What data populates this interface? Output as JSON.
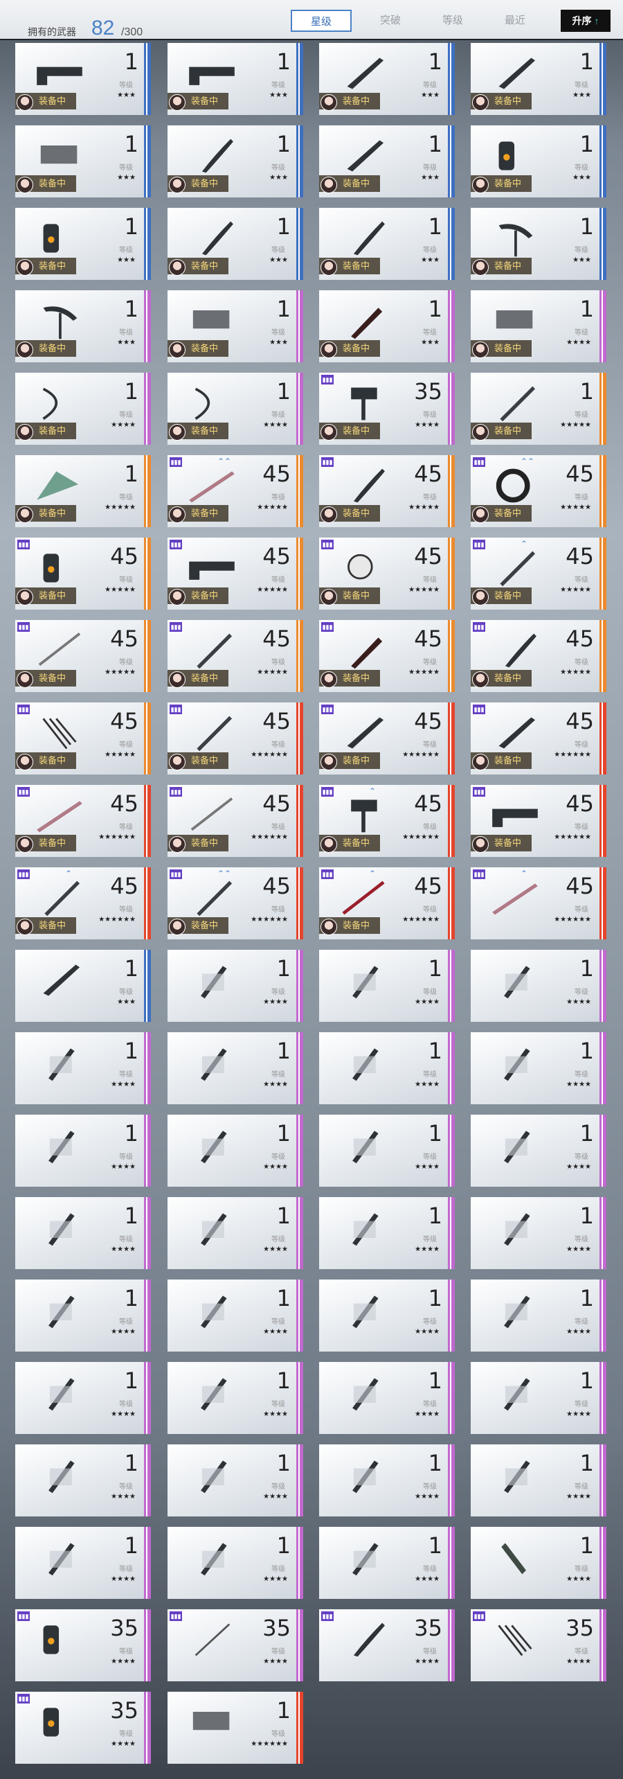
{
  "header": {
    "owned_label": "拥有的武器",
    "owned_count": "82",
    "owned_total": "/300",
    "tabs": [
      "星级",
      "突破",
      "等级",
      "最近"
    ],
    "active_tab": "星级",
    "sort_label": "升序",
    "sort_icon": "arrow-up-icon"
  },
  "colors": {
    "accent": "#4a82c6",
    "rarity_3": "#3e6fc1",
    "rarity_4": "#c169cf",
    "rarity_5": "#ec8a2e",
    "rarity_6": "#e5452d",
    "equipped_text": "#f4d67a"
  },
  "labels": {
    "level": "等级",
    "equipped": "装备中"
  },
  "weapons": [
    {
      "level": "1",
      "stars": "★★★",
      "rarity": 3,
      "equipped": true,
      "icon": "gun-icon"
    },
    {
      "level": "1",
      "stars": "★★★",
      "rarity": 3,
      "equipped": true,
      "icon": "gun-icon"
    },
    {
      "level": "1",
      "stars": "★★★",
      "rarity": 3,
      "equipped": true,
      "icon": "blade-icon"
    },
    {
      "level": "1",
      "stars": "★★★",
      "rarity": 3,
      "equipped": true,
      "icon": "blade-icon"
    },
    {
      "level": "1",
      "stars": "★★★",
      "rarity": 3,
      "equipped": true,
      "icon": "gauntlet-icon"
    },
    {
      "level": "1",
      "stars": "★★★",
      "rarity": 3,
      "equipped": true,
      "icon": "scythe-icon"
    },
    {
      "level": "1",
      "stars": "★★★",
      "rarity": 3,
      "equipped": true,
      "icon": "blade-icon"
    },
    {
      "level": "1",
      "stars": "★★★",
      "rarity": 3,
      "equipped": true,
      "icon": "cannon-icon"
    },
    {
      "level": "1",
      "stars": "★★★",
      "rarity": 3,
      "equipped": true,
      "icon": "cannon-icon"
    },
    {
      "level": "1",
      "stars": "★★★",
      "rarity": 3,
      "equipped": true,
      "icon": "scythe-icon"
    },
    {
      "level": "1",
      "stars": "★★★",
      "rarity": 3,
      "equipped": true,
      "icon": "scythe-icon"
    },
    {
      "level": "1",
      "stars": "★★★",
      "rarity": 3,
      "equipped": true,
      "icon": "pickaxe-icon"
    },
    {
      "level": "1",
      "stars": "★★★",
      "rarity": 4,
      "equipped": true,
      "icon": "pickaxe-icon"
    },
    {
      "level": "1",
      "stars": "★★★",
      "rarity": 4,
      "equipped": true,
      "icon": "gauntlet-icon"
    },
    {
      "level": "1",
      "stars": "★★★",
      "rarity": 4,
      "equipped": true,
      "icon": "chainsaw-icon"
    },
    {
      "level": "1",
      "stars": "★★★★",
      "rarity": 4,
      "equipped": true,
      "icon": "gauntlet-icon"
    },
    {
      "level": "1",
      "stars": "★★★★",
      "rarity": 4,
      "equipped": true,
      "icon": "bow-icon"
    },
    {
      "level": "1",
      "stars": "★★★★",
      "rarity": 4,
      "equipped": true,
      "icon": "bow-icon"
    },
    {
      "level": "35",
      "stars": "★★★★",
      "rarity": 4,
      "equipped": true,
      "icon": "hammer-icon",
      "badge": true
    },
    {
      "level": "1",
      "stars": "★★★★★",
      "rarity": 5,
      "equipped": true,
      "icon": "sword-icon"
    },
    {
      "level": "1",
      "stars": "★★★★★",
      "rarity": 5,
      "equipped": true,
      "icon": "fan-icon"
    },
    {
      "level": "45",
      "stars": "★★★★★",
      "rarity": 5,
      "equipped": true,
      "icon": "lance-icon",
      "badge": true,
      "ups": "⌃⌃"
    },
    {
      "level": "45",
      "stars": "★★★★★",
      "rarity": 5,
      "equipped": true,
      "icon": "scythe-icon",
      "badge": true
    },
    {
      "level": "45",
      "stars": "★★★★★",
      "rarity": 5,
      "equipped": true,
      "icon": "ring-icon",
      "badge": true,
      "ups": "⌃⌃"
    },
    {
      "level": "45",
      "stars": "★★★★★",
      "rarity": 5,
      "equipped": true,
      "icon": "cannon-icon",
      "badge": true
    },
    {
      "level": "45",
      "stars": "★★★★★",
      "rarity": 5,
      "equipped": true,
      "icon": "gun-icon",
      "badge": true
    },
    {
      "level": "45",
      "stars": "★★★★★",
      "rarity": 5,
      "equipped": true,
      "icon": "mech-icon",
      "badge": true
    },
    {
      "level": "45",
      "stars": "★★★★★",
      "rarity": 5,
      "equipped": true,
      "icon": "sword-icon",
      "badge": true,
      "ups": "⌃"
    },
    {
      "level": "45",
      "stars": "★★★★★",
      "rarity": 5,
      "equipped": true,
      "icon": "spear-icon",
      "badge": true
    },
    {
      "level": "45",
      "stars": "★★★★★",
      "rarity": 5,
      "equipped": true,
      "icon": "sword-icon",
      "badge": true
    },
    {
      "level": "45",
      "stars": "★★★★★",
      "rarity": 5,
      "equipped": true,
      "icon": "chainsaw-icon",
      "badge": true
    },
    {
      "level": "45",
      "stars": "★★★★★",
      "rarity": 5,
      "equipped": true,
      "icon": "scythe-icon",
      "badge": true
    },
    {
      "level": "45",
      "stars": "★★★★★",
      "rarity": 5,
      "equipped": true,
      "icon": "claw-icon",
      "badge": true
    },
    {
      "level": "45",
      "stars": "★★★★★★",
      "rarity": 6,
      "equipped": true,
      "icon": "sword-icon",
      "badge": true
    },
    {
      "level": "45",
      "stars": "★★★★★★",
      "rarity": 6,
      "equipped": true,
      "icon": "blade-icon",
      "badge": true
    },
    {
      "level": "45",
      "stars": "★★★★★★",
      "rarity": 6,
      "equipped": true,
      "icon": "blade-icon",
      "badge": true
    },
    {
      "level": "45",
      "stars": "★★★★★★",
      "rarity": 6,
      "equipped": true,
      "icon": "lance-icon",
      "badge": true
    },
    {
      "level": "45",
      "stars": "★★★★★★",
      "rarity": 6,
      "equipped": true,
      "icon": "spear-icon",
      "badge": true
    },
    {
      "level": "45",
      "stars": "★★★★★★",
      "rarity": 6,
      "equipped": true,
      "icon": "hammer-icon",
      "badge": true,
      "ups": "⌃"
    },
    {
      "level": "45",
      "stars": "★★★★★★",
      "rarity": 6,
      "equipped": true,
      "icon": "gun-icon",
      "badge": true
    },
    {
      "level": "45",
      "stars": "★★★★★★",
      "rarity": 6,
      "equipped": true,
      "icon": "sword-icon",
      "badge": true,
      "ups": "⌃"
    },
    {
      "level": "45",
      "stars": "★★★★★★",
      "rarity": 6,
      "equipped": true,
      "icon": "sword-icon",
      "badge": true,
      "ups": "⌃⌃"
    },
    {
      "level": "45",
      "stars": "★★★★★★",
      "rarity": 6,
      "equipped": true,
      "icon": "katana-icon",
      "badge": true,
      "ups": "⌃"
    },
    {
      "level": "45",
      "stars": "★★★★★★",
      "rarity": 6,
      "equipped": false,
      "icon": "lance-icon",
      "badge": true,
      "ups": "⌃"
    },
    {
      "level": "1",
      "stars": "★★★",
      "rarity": 3,
      "equipped": false,
      "icon": "blade-icon"
    },
    {
      "level": "1",
      "stars": "★★★★",
      "rarity": 4,
      "equipped": false,
      "icon": "dagger-icon"
    },
    {
      "level": "1",
      "stars": "★★★★",
      "rarity": 4,
      "equipped": false,
      "icon": "dagger-icon"
    },
    {
      "level": "1",
      "stars": "★★★★",
      "rarity": 4,
      "equipped": false,
      "icon": "dagger-icon"
    },
    {
      "level": "1",
      "stars": "★★★★",
      "rarity": 4,
      "equipped": false,
      "icon": "dagger-icon"
    },
    {
      "level": "1",
      "stars": "★★★★",
      "rarity": 4,
      "equipped": false,
      "icon": "dagger-icon"
    },
    {
      "level": "1",
      "stars": "★★★★",
      "rarity": 4,
      "equipped": false,
      "icon": "dagger-icon"
    },
    {
      "level": "1",
      "stars": "★★★★",
      "rarity": 4,
      "equipped": false,
      "icon": "dagger-icon"
    },
    {
      "level": "1",
      "stars": "★★★★",
      "rarity": 4,
      "equipped": false,
      "icon": "dagger-icon"
    },
    {
      "level": "1",
      "stars": "★★★★",
      "rarity": 4,
      "equipped": false,
      "icon": "dagger-icon"
    },
    {
      "level": "1",
      "stars": "★★★★",
      "rarity": 4,
      "equipped": false,
      "icon": "dagger-icon"
    },
    {
      "level": "1",
      "stars": "★★★★",
      "rarity": 4,
      "equipped": false,
      "icon": "dagger-icon"
    },
    {
      "level": "1",
      "stars": "★★★★",
      "rarity": 4,
      "equipped": false,
      "icon": "dagger-icon"
    },
    {
      "level": "1",
      "stars": "★★★★",
      "rarity": 4,
      "equipped": false,
      "icon": "dagger-icon"
    },
    {
      "level": "1",
      "stars": "★★★★",
      "rarity": 4,
      "equipped": false,
      "icon": "dagger-icon"
    },
    {
      "level": "1",
      "stars": "★★★★",
      "rarity": 4,
      "equipped": false,
      "icon": "dagger-icon"
    },
    {
      "level": "1",
      "stars": "★★★★",
      "rarity": 4,
      "equipped": false,
      "icon": "dagger-icon"
    },
    {
      "level": "1",
      "stars": "★★★★",
      "rarity": 4,
      "equipped": false,
      "icon": "dagger-icon"
    },
    {
      "level": "1",
      "stars": "★★★★",
      "rarity": 4,
      "equipped": false,
      "icon": "dagger-icon"
    },
    {
      "level": "1",
      "stars": "★★★★",
      "rarity": 4,
      "equipped": false,
      "icon": "dagger-icon"
    },
    {
      "level": "1",
      "stars": "★★★★",
      "rarity": 4,
      "equipped": false,
      "icon": "dagger-icon"
    },
    {
      "level": "1",
      "stars": "★★★★",
      "rarity": 4,
      "equipped": false,
      "icon": "dagger-icon"
    },
    {
      "level": "1",
      "stars": "★★★★",
      "rarity": 4,
      "equipped": false,
      "icon": "dagger-icon"
    },
    {
      "level": "1",
      "stars": "★★★★",
      "rarity": 4,
      "equipped": false,
      "icon": "dagger-icon"
    },
    {
      "level": "1",
      "stars": "★★★★",
      "rarity": 4,
      "equipped": false,
      "icon": "dagger-icon"
    },
    {
      "level": "1",
      "stars": "★★★★",
      "rarity": 4,
      "equipped": false,
      "icon": "dagger-icon"
    },
    {
      "level": "1",
      "stars": "★★★★",
      "rarity": 4,
      "equipped": false,
      "icon": "dagger-icon"
    },
    {
      "level": "1",
      "stars": "★★★★",
      "rarity": 4,
      "equipped": false,
      "icon": "dagger-icon"
    },
    {
      "level": "1",
      "stars": "★★★★",
      "rarity": 4,
      "equipped": false,
      "icon": "dagger-icon"
    },
    {
      "level": "1",
      "stars": "★★★★",
      "rarity": 4,
      "equipped": false,
      "icon": "dagger-icon"
    },
    {
      "level": "1",
      "stars": "★★★★",
      "rarity": 4,
      "equipped": false,
      "icon": "dagger-icon"
    },
    {
      "level": "1",
      "stars": "★★★★",
      "rarity": 4,
      "equipped": false,
      "icon": "knife-icon"
    },
    {
      "level": "35",
      "stars": "★★★★",
      "rarity": 4,
      "equipped": false,
      "icon": "cannon-icon",
      "badge": true
    },
    {
      "level": "35",
      "stars": "★★★★",
      "rarity": 4,
      "equipped": false,
      "icon": "staff-icon",
      "badge": true
    },
    {
      "level": "35",
      "stars": "★★★★",
      "rarity": 4,
      "equipped": false,
      "icon": "scythe-icon",
      "badge": true
    },
    {
      "level": "35",
      "stars": "★★★★",
      "rarity": 4,
      "equipped": false,
      "icon": "claw-icon",
      "badge": true
    },
    {
      "level": "35",
      "stars": "★★★★",
      "rarity": 4,
      "equipped": false,
      "icon": "cannon-icon",
      "badge": true
    },
    {
      "level": "1",
      "stars": "★★★★★★",
      "rarity": 6,
      "equipped": false,
      "icon": "gauntlet-icon"
    }
  ]
}
